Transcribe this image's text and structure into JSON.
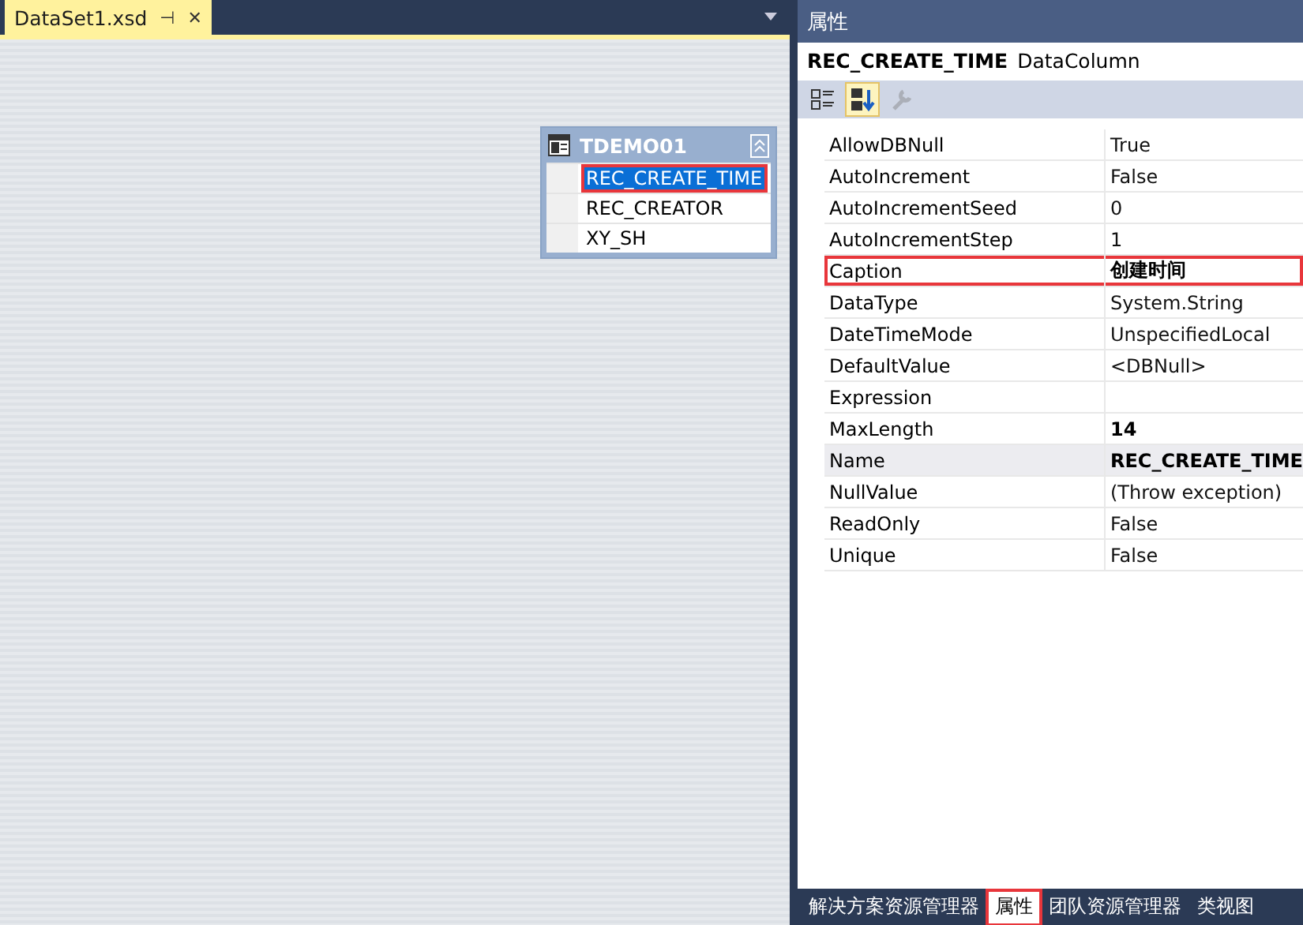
{
  "document_tab": {
    "title": "DataSet1.xsd",
    "pin": "⊣",
    "close": "✕"
  },
  "table": {
    "name": "TDEMO01",
    "columns": [
      {
        "name": "REC_CREATE_TIME",
        "selected": true,
        "highlighted": true
      },
      {
        "name": "REC_CREATOR",
        "selected": false,
        "highlighted": false
      },
      {
        "name": "XY_SH",
        "selected": false,
        "highlighted": false
      }
    ]
  },
  "properties": {
    "title": "属性",
    "object_name": "REC_CREATE_TIME",
    "object_type": "DataColumn",
    "toolbar": [
      {
        "kind": "categorized",
        "selected": false,
        "disabled": false
      },
      {
        "kind": "alphabetical",
        "selected": true,
        "disabled": false
      },
      {
        "kind": "pages",
        "selected": false,
        "disabled": true
      }
    ],
    "rows": [
      {
        "name": "AllowDBNull",
        "value": "True",
        "modified": false,
        "selected": false,
        "highlighted": false
      },
      {
        "name": "AutoIncrement",
        "value": "False",
        "modified": false,
        "selected": false,
        "highlighted": false
      },
      {
        "name": "AutoIncrementSeed",
        "value": "0",
        "modified": false,
        "selected": false,
        "highlighted": false
      },
      {
        "name": "AutoIncrementStep",
        "value": "1",
        "modified": false,
        "selected": false,
        "highlighted": false
      },
      {
        "name": "Caption",
        "value": "创建时间",
        "modified": true,
        "selected": false,
        "highlighted": true
      },
      {
        "name": "DataType",
        "value": "System.String",
        "modified": false,
        "selected": false,
        "highlighted": false
      },
      {
        "name": "DateTimeMode",
        "value": "UnspecifiedLocal",
        "modified": false,
        "selected": false,
        "highlighted": false
      },
      {
        "name": "DefaultValue",
        "value": "<DBNull>",
        "modified": false,
        "selected": false,
        "highlighted": false
      },
      {
        "name": "Expression",
        "selected": false,
        "highlighted": false
      },
      {
        "name": "MaxLength",
        "value": "14",
        "modified": true,
        "selected": false,
        "highlighted": false
      },
      {
        "name": "Name",
        "value": "REC_CREATE_TIME",
        "modified": true,
        "selected": true,
        "highlighted": false
      },
      {
        "name": "NullValue",
        "value": "(Throw exception)",
        "modified": false,
        "selected": false,
        "highlighted": false
      },
      {
        "name": "ReadOnly",
        "value": "False",
        "modified": false,
        "selected": false,
        "highlighted": false
      },
      {
        "name": "Unique",
        "value": "False",
        "modified": false,
        "selected": false,
        "highlighted": false
      }
    ]
  },
  "bottom_tabs": [
    {
      "label": "解决方案资源管理器",
      "selected": false,
      "highlighted": false
    },
    {
      "label": "属性",
      "selected": true,
      "highlighted": true
    },
    {
      "label": "团队资源管理器",
      "selected": false,
      "highlighted": false
    },
    {
      "label": "类视图",
      "selected": false,
      "highlighted": false
    }
  ]
}
